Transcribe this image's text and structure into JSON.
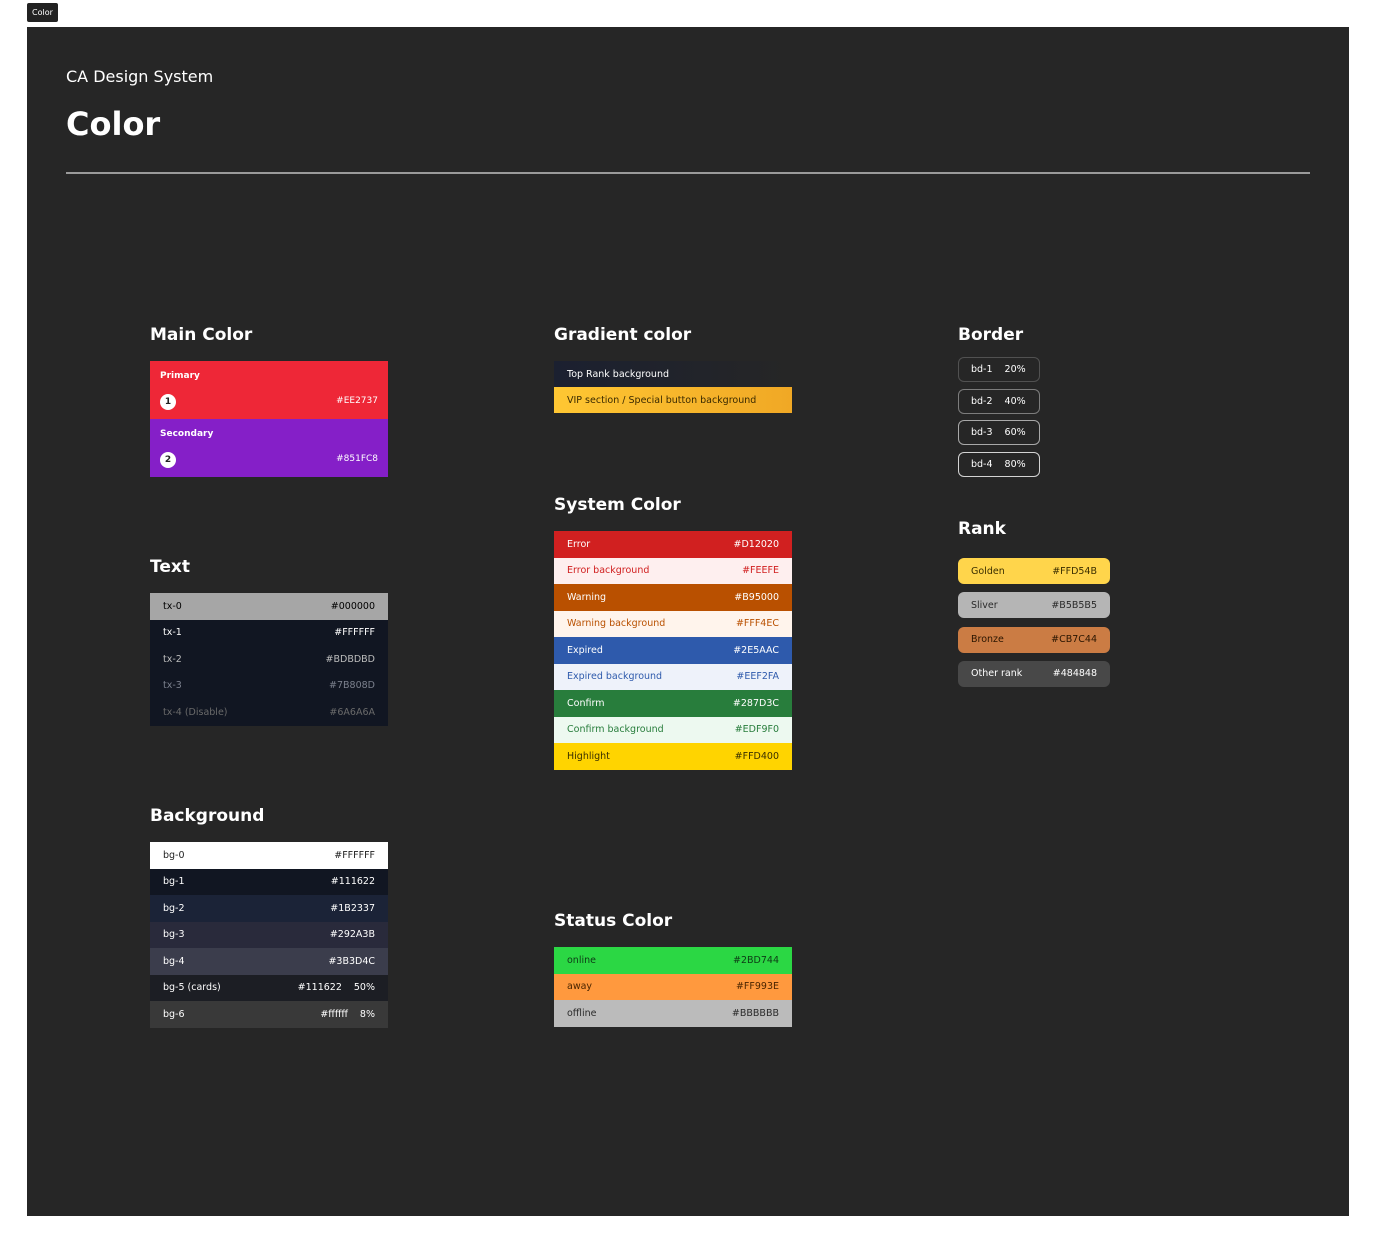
{
  "frame_tag": "Color",
  "header": {
    "subtitle": "CA Design System",
    "title": "Color"
  },
  "main_color": {
    "heading": "Main Color",
    "items": [
      {
        "label": "Primary",
        "number": "1",
        "hex": "#EE2737",
        "color": "#EE2737"
      },
      {
        "label": "Secondary",
        "number": "2",
        "hex": "#851FC8",
        "color": "#851FC8"
      }
    ]
  },
  "text_colors": {
    "heading": "Text",
    "rows": [
      {
        "name": "tx-0",
        "hex": "#000000",
        "bg": "#A6A6A6",
        "fg": "#000000"
      },
      {
        "name": "tx-1",
        "hex": "#FFFFFF",
        "bg": "#111622",
        "fg": "#FFFFFF"
      },
      {
        "name": "tx-2",
        "hex": "#BDBDBD",
        "bg": "#111622",
        "fg": "#BDBDBD"
      },
      {
        "name": "tx-3",
        "hex": "#7B808D",
        "bg": "#111622",
        "fg": "#7B808D"
      },
      {
        "name": "tx-4 (Disable)",
        "hex": "#6A6A6A",
        "bg": "#111622",
        "fg": "#6A6A6A"
      }
    ]
  },
  "background_colors": {
    "heading": "Background",
    "rows": [
      {
        "name": "bg-0",
        "hex": "#FFFFFF",
        "extra": "",
        "bg": "#FFFFFF",
        "fg": "#222222"
      },
      {
        "name": "bg-1",
        "hex": "#111622",
        "extra": "",
        "bg": "#111622",
        "fg": "#FFFFFF"
      },
      {
        "name": "bg-2",
        "hex": "#1B2337",
        "extra": "",
        "bg": "#1B2337",
        "fg": "#FFFFFF"
      },
      {
        "name": "bg-3",
        "hex": "#292A3B",
        "extra": "",
        "bg": "#292A3B",
        "fg": "#FFFFFF"
      },
      {
        "name": "bg-4",
        "hex": "#3B3D4C",
        "extra": "",
        "bg": "#3B3D4C",
        "fg": "#FFFFFF"
      },
      {
        "name": "bg-5 (cards)",
        "hex": "#111622",
        "extra": "50%",
        "bg": "#1C1E24",
        "fg": "#FFFFFF"
      },
      {
        "name": "bg-6",
        "hex": "#ffffff",
        "extra": "8%",
        "bg": "#393939",
        "fg": "#FFFFFF"
      }
    ]
  },
  "gradient_color": {
    "heading": "Gradient color",
    "rows": [
      {
        "label": "Top Rank background",
        "from": "#1B2030",
        "to": "#262626",
        "fg": "#FFFFFF"
      },
      {
        "label": "VIP section / Special button background",
        "from": "#FFC733",
        "to": "#F0A825",
        "fg": "#3A2A00"
      }
    ]
  },
  "system_color": {
    "heading": "System Color",
    "rows": [
      {
        "name": "Error",
        "hex": "#D12020",
        "bg": "#D12020",
        "fg": "#FFFFFF"
      },
      {
        "name": "Error background",
        "hex": "#FEEFE",
        "bg": "#FEEFEF",
        "fg": "#D12020"
      },
      {
        "name": "Warning",
        "hex": "#B95000",
        "bg": "#B95000",
        "fg": "#FFFFFF"
      },
      {
        "name": "Warning background",
        "hex": "#FFF4EC",
        "bg": "#FFF4EC",
        "fg": "#B95000"
      },
      {
        "name": "Expired",
        "hex": "#2E5AAC",
        "bg": "#2E5AAC",
        "fg": "#FFFFFF"
      },
      {
        "name": "Expired background",
        "hex": "#EEF2FA",
        "bg": "#EEF2FA",
        "fg": "#2E5AAC"
      },
      {
        "name": "Confirm",
        "hex": "#287D3C",
        "bg": "#287D3C",
        "fg": "#FFFFFF"
      },
      {
        "name": "Confirm background",
        "hex": "#EDF9F0",
        "bg": "#EDF9F0",
        "fg": "#287D3C"
      },
      {
        "name": "Highlight",
        "hex": "#FFD400",
        "bg": "#FFD400",
        "fg": "#3A3000"
      }
    ]
  },
  "status_color": {
    "heading": "Status Color",
    "rows": [
      {
        "name": "online",
        "hex": "#2BD744",
        "bg": "#2BD744",
        "fg": "#0E3A16"
      },
      {
        "name": "away",
        "hex": "#FF993E",
        "bg": "#FF993E",
        "fg": "#4A2500"
      },
      {
        "name": "offline",
        "hex": "#BBBBBB",
        "bg": "#BBBBBB",
        "fg": "#2A2A2A"
      }
    ]
  },
  "border": {
    "heading": "Border",
    "items": [
      {
        "name": "bd-1",
        "opacity": "20%",
        "color": "rgba(255,255,255,0.2)"
      },
      {
        "name": "bd-2",
        "opacity": "40%",
        "color": "rgba(255,255,255,0.4)"
      },
      {
        "name": "bd-3",
        "opacity": "60%",
        "color": "rgba(255,255,255,0.6)"
      },
      {
        "name": "bd-4",
        "opacity": "80%",
        "color": "rgba(255,255,255,0.8)"
      }
    ]
  },
  "rank": {
    "heading": "Rank",
    "items": [
      {
        "name": "Golden",
        "hex": "#FFD54B",
        "bg": "#FFD54B",
        "fg": "#3A2E00"
      },
      {
        "name": "Sliver",
        "hex": "#B5B5B5",
        "bg": "#B5B5B5",
        "fg": "#2A2A2A"
      },
      {
        "name": "Bronze",
        "hex": "#CB7C44",
        "bg": "#CB7C44",
        "fg": "#2A1500"
      },
      {
        "name": "Other rank",
        "hex": "#484848",
        "bg": "#484848",
        "fg": "#FFFFFF"
      }
    ]
  }
}
